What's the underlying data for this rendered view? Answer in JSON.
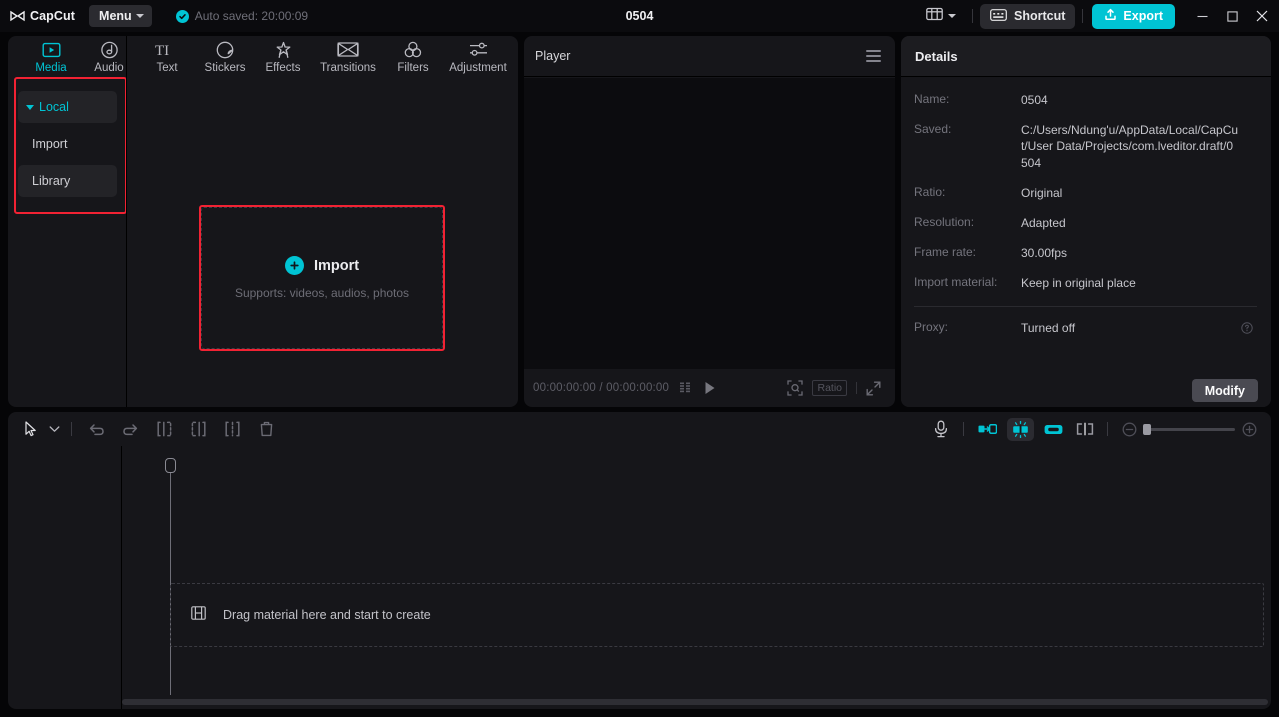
{
  "titlebar": {
    "logo_text": "CapCut",
    "menu_label": "Menu",
    "autosave_text": "Auto saved: 20:00:09",
    "project_title": "0504",
    "layout_icon": "layout-icon",
    "shortcut_label": "Shortcut",
    "export_label": "Export",
    "minimize_icon": "minimize-icon",
    "maximize_icon": "maximize-icon",
    "close_icon": "close-icon",
    "accent_color": "#00c4d4"
  },
  "nav_tabs": [
    {
      "label": "Media",
      "icon": "media-icon",
      "active": true
    },
    {
      "label": "Audio",
      "icon": "audio-icon",
      "active": false
    },
    {
      "label": "Text",
      "icon": "text-icon",
      "active": false
    },
    {
      "label": "Stickers",
      "icon": "stickers-icon",
      "active": false
    },
    {
      "label": "Effects",
      "icon": "effects-icon",
      "active": false
    },
    {
      "label": "Transitions",
      "icon": "transitions-icon",
      "active": false
    },
    {
      "label": "Filters",
      "icon": "filters-icon",
      "active": false
    },
    {
      "label": "Adjustment",
      "icon": "adjustment-icon",
      "active": false
    }
  ],
  "sidebar": {
    "items": [
      {
        "label": "Local",
        "type": "group",
        "expanded": true
      },
      {
        "label": "Import",
        "type": "item",
        "selected": false
      },
      {
        "label": "Library",
        "type": "item",
        "selected": true
      }
    ]
  },
  "dropzone": {
    "title": "Import",
    "subtitle": "Supports: videos, audios, photos",
    "plus_icon": "plus-icon"
  },
  "player": {
    "title": "Player",
    "menu_icon": "hamburger-icon",
    "current_time": "00:00:00:00",
    "total_time": "00:00:00:00",
    "time_separator": "/",
    "frame_back_icon": "frame-back-icon",
    "frame_forward_icon": "frame-forward-icon",
    "play_icon": "play-icon",
    "fit_icon": "fit-to-screen-icon",
    "ratio_label": "Ratio",
    "fullscreen_icon": "fullscreen-icon"
  },
  "details": {
    "title": "Details",
    "rows": [
      {
        "label": "Name:",
        "value": "0504"
      },
      {
        "label": "Saved:",
        "value": "C:/Users/Ndung'u/AppData/Local/CapCut/User Data/Projects/com.lveditor.draft/0504"
      },
      {
        "label": "Ratio:",
        "value": "Original"
      },
      {
        "label": "Resolution:",
        "value": "Adapted"
      },
      {
        "label": "Frame rate:",
        "value": "30.00fps"
      },
      {
        "label": "Import material:",
        "value": "Keep in original place"
      }
    ],
    "proxy": {
      "label": "Proxy:",
      "value": "Turned off",
      "help_icon": "help-icon"
    },
    "modify_label": "Modify"
  },
  "timeline": {
    "tools_left": [
      {
        "name": "cursor-tool",
        "icon": "cursor-icon"
      },
      {
        "name": "cursor-dropdown",
        "icon": "chevron-down-icon"
      },
      {
        "name": "undo-button",
        "icon": "undo-icon"
      },
      {
        "name": "redo-button",
        "icon": "redo-icon"
      },
      {
        "name": "split-left-button",
        "icon": "split-left-icon"
      },
      {
        "name": "split-right-button",
        "icon": "split-right-icon"
      },
      {
        "name": "split-both-button",
        "icon": "split-both-icon"
      },
      {
        "name": "delete-button",
        "icon": "trash-icon"
      }
    ],
    "tools_right": [
      {
        "name": "record-button",
        "icon": "microphone-icon"
      },
      {
        "name": "mirror-button",
        "icon": "mirror-icon"
      },
      {
        "name": "snap-button",
        "icon": "snap-icon"
      },
      {
        "name": "link-button",
        "icon": "link-icon"
      },
      {
        "name": "adjacent-split-button",
        "icon": "adjacent-split-icon"
      },
      {
        "name": "zoom-out-button",
        "icon": "zoom-out-icon"
      },
      {
        "name": "zoom-in-button",
        "icon": "zoom-in-icon"
      }
    ],
    "drop_text": "Drag material here and start to create",
    "drop_icon": "film-strip-icon",
    "zoom_value": 0
  }
}
